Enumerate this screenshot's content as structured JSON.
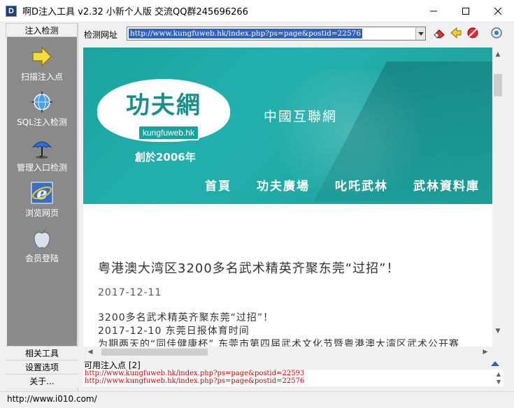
{
  "window": {
    "app_icon_letter": "D",
    "title": "啊D注入工具 v2.32 小新个人版 交流QQ群245696266"
  },
  "sidebar": {
    "header": "注入检测",
    "items": [
      {
        "label": "扫描注入点",
        "icon": "arrow-right-icon"
      },
      {
        "label": "SQL注入检测",
        "icon": "globe-icon"
      },
      {
        "label": "管理入口检测",
        "icon": "umbrella-icon"
      },
      {
        "label": "浏览网页",
        "icon": "ie-icon"
      },
      {
        "label": "会员登陆",
        "icon": "apple-icon"
      }
    ],
    "bottom": [
      "相关工具",
      "设置选项",
      "关于..."
    ]
  },
  "urlbar": {
    "label": "检测网址",
    "value": "http://www.kungfuweb.hk/index.php?ps=page&postid=22576"
  },
  "webpage": {
    "logo_text": "功夫網",
    "logo_domain": "kungfuweb.hk",
    "logo_since": "創於2006年",
    "site_subtitle": "中國互聯網",
    "nav": [
      "首頁",
      "功夫廣場",
      "叱吒武林",
      "武林資料庫"
    ],
    "article_title": "粤港澳大湾区3200多名武术精英齐聚东莞“过招”！",
    "article_date": "2017-12-11",
    "body_lines": [
      "3200多名武术精英齐聚东莞“过招”！",
      "2017-12-10  东莞日报体育时间",
      "为期两天的“同佳健康杯”  东莞市第四届武术文化节暨粤港澳大湾区武术公开赛"
    ]
  },
  "injection": {
    "header": "可用注入点 [2]",
    "items": [
      "http://www.kungfuweb.hk/index.php?ps=page&postid=22593",
      "http://www.kungfuweb.hk/index.php?ps=page&postid=22576"
    ]
  },
  "statusbar": {
    "text": "http://www.i010.com/"
  },
  "colors": {
    "banner_teal": "#1aa39e",
    "url_highlight": "#3060c0",
    "injection_red": "#c00000"
  }
}
